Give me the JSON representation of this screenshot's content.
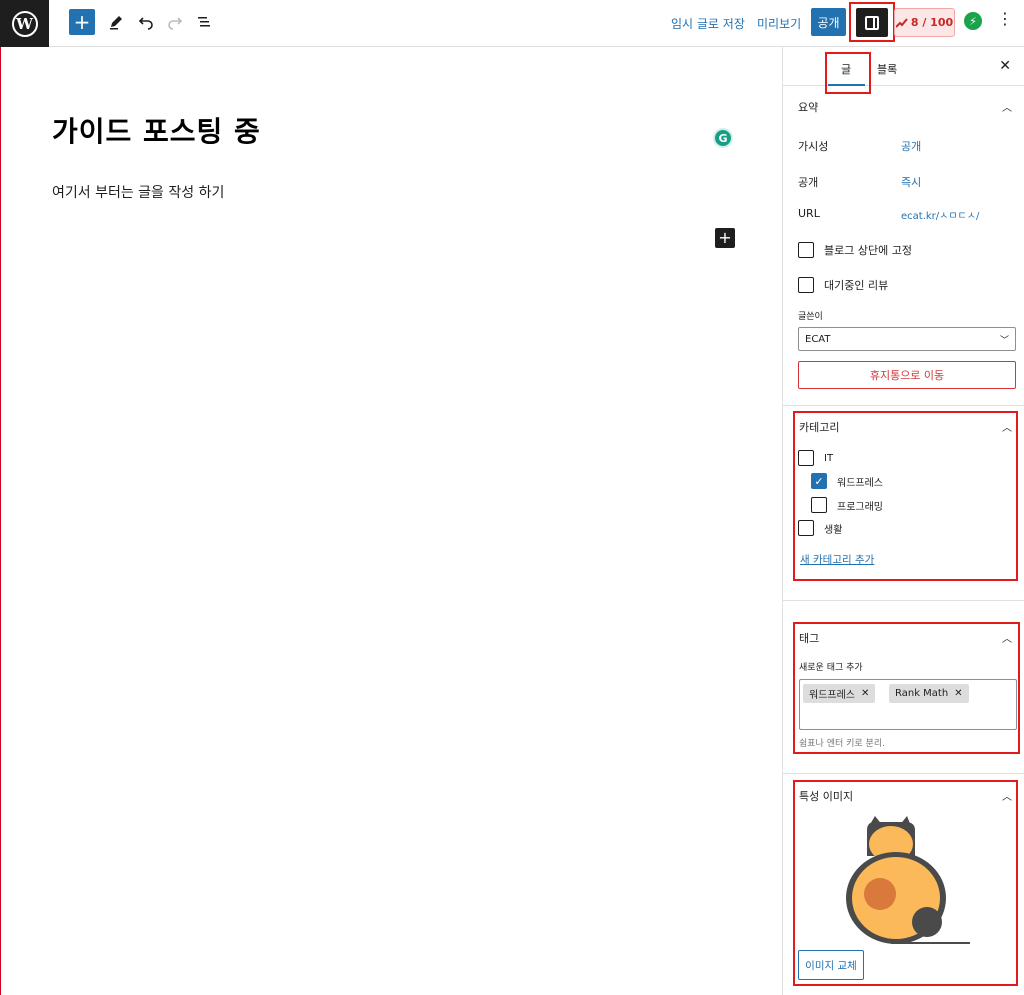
{
  "toolbar": {
    "logo_glyph": "W",
    "add_glyph": "+",
    "save_draft": "임시 글로 저장",
    "preview": "미리보기",
    "publish": "공개",
    "rank_score": "8 / 100",
    "more_glyph": "⋮"
  },
  "editor": {
    "title": "가이드 포스팅 중",
    "body": "여기서 부터는 글을 작성 하기",
    "grammarly_glyph": "G",
    "block_add_glyph": "+"
  },
  "sidebar": {
    "tabs": {
      "post": "글",
      "block": "블록"
    },
    "close_glyph": "✕",
    "summary": {
      "title": "요약",
      "rows": [
        {
          "label": "가시성",
          "value": "공개"
        },
        {
          "label": "공개",
          "value": "즉시"
        },
        {
          "label": "URL",
          "value": "ecat.kr/ㅅㅁㄷㅅ/"
        }
      ],
      "sticky": "블로그 상단에 고정",
      "pending": "대기중인 리뷰",
      "author_label": "글쓴이",
      "author_value": "ECAT",
      "trash": "휴지통으로 이동"
    },
    "categories": {
      "title": "카테고리",
      "items": [
        {
          "label": "IT",
          "checked": false
        },
        {
          "label": "워드프레스",
          "checked": true
        },
        {
          "label": "프로그래밍",
          "checked": false
        },
        {
          "label": "생활",
          "checked": false
        }
      ],
      "add_new": "새 카테고리 추가"
    },
    "tags": {
      "title": "태그",
      "add_label": "새로운 태그 추가",
      "chips": [
        "워드프레스",
        "Rank Math"
      ],
      "hint": "쉼표나 엔터 키로 분리."
    },
    "featured_image": {
      "title": "특성 이미지",
      "replace": "이미지 교체"
    }
  },
  "colors": {
    "accent": "#2271b1",
    "highlight": "#e01b1b",
    "rank_bad": "#c62828",
    "cat_body": "#fbb95a",
    "cat_dark": "#4a4a4a",
    "cat_spot": "#d9793c"
  }
}
